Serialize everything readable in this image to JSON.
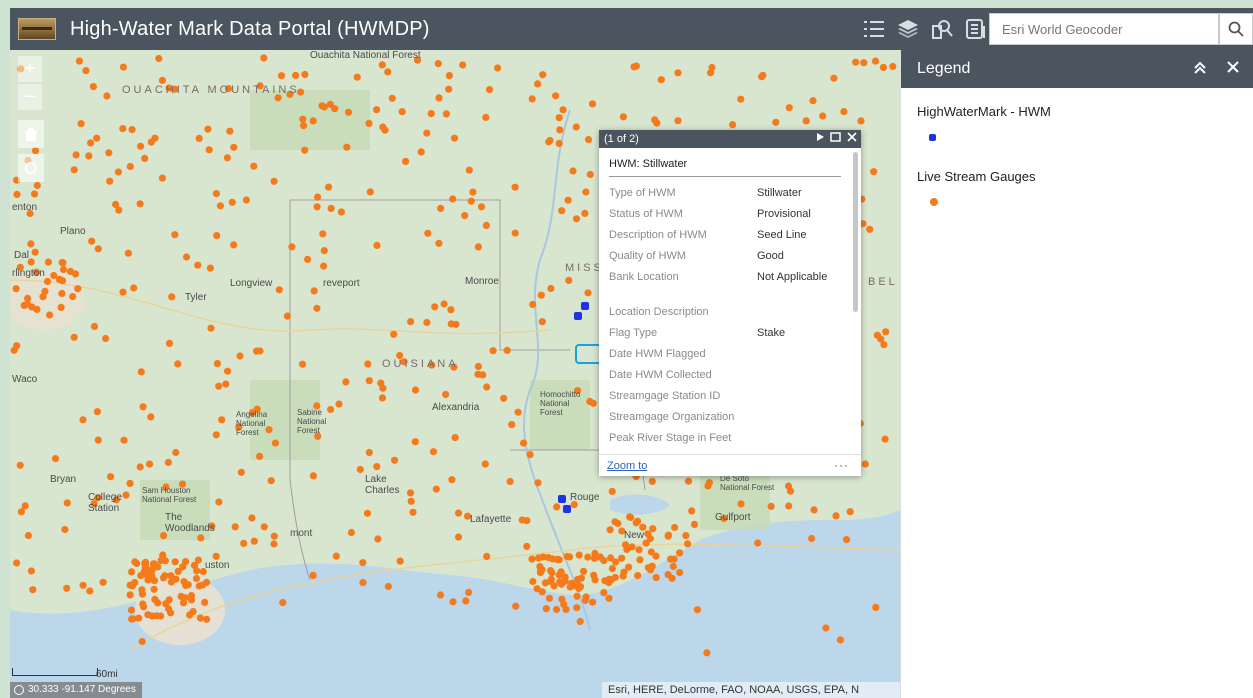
{
  "header": {
    "title": "High-Water Mark Data Portal (HWMDP)",
    "tools": [
      "legend-list-icon",
      "layers-icon",
      "query-icon",
      "attribute-table-icon"
    ]
  },
  "search": {
    "placeholder": "Esri World Geocoder"
  },
  "map": {
    "labels": {
      "ouachita_forest": "Ouachita National Forest",
      "ouachita_mountains": "OUACHITA MOUNTAINS",
      "plano": "Plano",
      "dallas": "Dal",
      "arlington": "rlington",
      "denton": "enton",
      "tyler": "Tyler",
      "longview": "Longview",
      "shreveport": "reveport",
      "monroe": "Monroe",
      "mississippi": "MISSI",
      "louisiana": "OUISIANA",
      "alexandria": "Alexandria",
      "angelina": "Angelina National Forest",
      "sabine": "Sabine National Forest",
      "homochitto": "Homochitto National Forest",
      "waco": "Waco",
      "bryan": "Bryan",
      "college_station": "College Station",
      "sam_houston": "Sam Houston National Forest",
      "the_woodlands": "The Woodlands",
      "houston": "uston",
      "beaumont": "mont",
      "lake_charles": "Lake Charles",
      "lafayette": "Lafayette",
      "baton_rouge": "Rouge",
      "new_orleans": "New",
      "desoto": "De Soto National Forest",
      "gulfport": "Gulfport",
      "scale": "60mi",
      "alabama_partial": "BEL"
    },
    "coordinates": "30.333 -91.147 Degrees",
    "attribution": "Esri, HERE, DeLorme, FAO, NOAA, USGS, EPA, N",
    "controls": {
      "zoom_in": "+",
      "zoom_out": "−"
    }
  },
  "popup": {
    "counter": "(1 of 2)",
    "title": "HWM: Stillwater",
    "attributes": [
      {
        "name": "Type of HWM",
        "value": "Stillwater"
      },
      {
        "name": "Status of HWM",
        "value": "Provisional"
      },
      {
        "name": "Description of HWM",
        "value": "Seed Line"
      },
      {
        "name": "Quality of HWM",
        "value": "Good"
      },
      {
        "name": "Bank Location",
        "value": "Not Applicable"
      },
      {
        "name": "Location Description",
        "value": ""
      },
      {
        "name": "Flag Type",
        "value": "Stake"
      },
      {
        "name": "Date HWM Flagged",
        "value": ""
      },
      {
        "name": "Date HWM Collected",
        "value": ""
      },
      {
        "name": "Streamgage Station ID",
        "value": ""
      },
      {
        "name": "Streamgage Organization",
        "value": ""
      },
      {
        "name": "Peak River Stage in Feet",
        "value": ""
      }
    ],
    "zoom_to": "Zoom to",
    "more": "···"
  },
  "legend": {
    "title": "Legend",
    "layers": [
      {
        "name": "HighWaterMark - HWM",
        "color": "#1f33e0"
      },
      {
        "name": "Live Stream Gauges",
        "color": "#f47a1c"
      }
    ]
  },
  "colors": {
    "header_bg": "#4b5560",
    "gauge_orange": "#f47a1c",
    "hwm_blue": "#1f33e0",
    "water": "#bcd6ea"
  }
}
